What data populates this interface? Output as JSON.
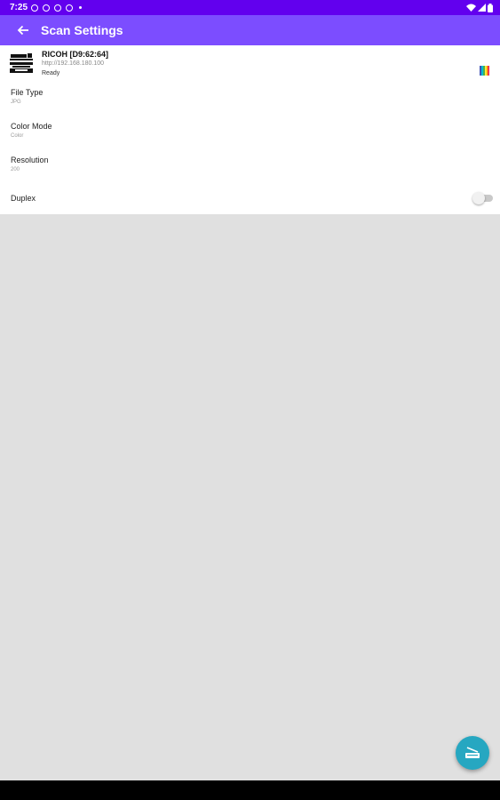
{
  "status_bar": {
    "time": "7:25",
    "left_icons": [
      "shield-icon",
      "notification-icon",
      "alert-icon",
      "cube-icon"
    ],
    "right_icons": [
      "wifi-icon",
      "signal-icon",
      "battery-icon"
    ]
  },
  "app_bar": {
    "title": "Scan Settings",
    "back_icon": "arrow-back-icon",
    "color": "#7c4dff"
  },
  "printer": {
    "name": "RICOH [D9:62:64]",
    "url": "http://192.168.180.100",
    "status": "Ready",
    "mode_icon": "color-bars-icon"
  },
  "settings": [
    {
      "label": "File Type",
      "value": "JPG"
    },
    {
      "label": "Color Mode",
      "value": "Color"
    },
    {
      "label": "Resolution",
      "value": "200"
    }
  ],
  "duplex": {
    "label": "Duplex",
    "enabled": false
  },
  "fab": {
    "icon": "scanner-icon",
    "color": "#26a7c1"
  }
}
